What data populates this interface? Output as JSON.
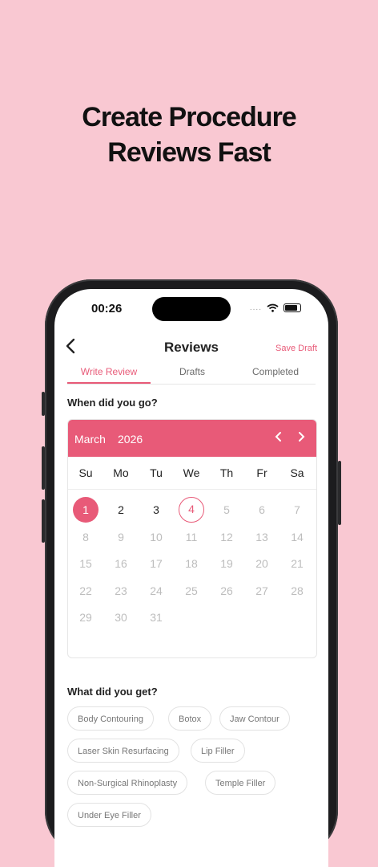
{
  "promo": {
    "line1": "Create Procedure",
    "line2": "Reviews Fast"
  },
  "status": {
    "time": "00:26",
    "dots": "...."
  },
  "header": {
    "title": "Reviews",
    "save_label": "Save Draft"
  },
  "tabs": [
    {
      "label": "Write Review",
      "active": true
    },
    {
      "label": "Drafts",
      "active": false
    },
    {
      "label": "Completed",
      "active": false
    }
  ],
  "sections": {
    "when": "When did you go?",
    "what": "What did you get?"
  },
  "calendar": {
    "month": "March",
    "year": "2026",
    "weekdays": [
      "Su",
      "Mo",
      "Tu",
      "We",
      "Th",
      "Fr",
      "Sa"
    ],
    "days": [
      "1",
      "2",
      "3",
      "4",
      "5",
      "6",
      "7",
      "8",
      "9",
      "10",
      "11",
      "12",
      "13",
      "14",
      "15",
      "16",
      "17",
      "18",
      "19",
      "20",
      "21",
      "22",
      "23",
      "24",
      "25",
      "26",
      "27",
      "28",
      "29",
      "30",
      "31"
    ],
    "selected_day": "1",
    "today_day": "4",
    "available_days": [
      "1",
      "2",
      "3",
      "4"
    ],
    "start_weekday_index": 0,
    "colors": {
      "accent": "#e85a78",
      "disabled": "#bdbdbd"
    }
  },
  "procedures": [
    "Body Contouring",
    "Botox",
    "Jaw Contour",
    "Laser Skin Resurfacing",
    "Lip Filler",
    "Non-Surgical Rhinoplasty",
    "Temple Filler",
    "Under Eye Filler"
  ],
  "icons": {
    "back": "chevron-left-icon",
    "prev": "chevron-left-icon",
    "next": "chevron-right-icon"
  }
}
